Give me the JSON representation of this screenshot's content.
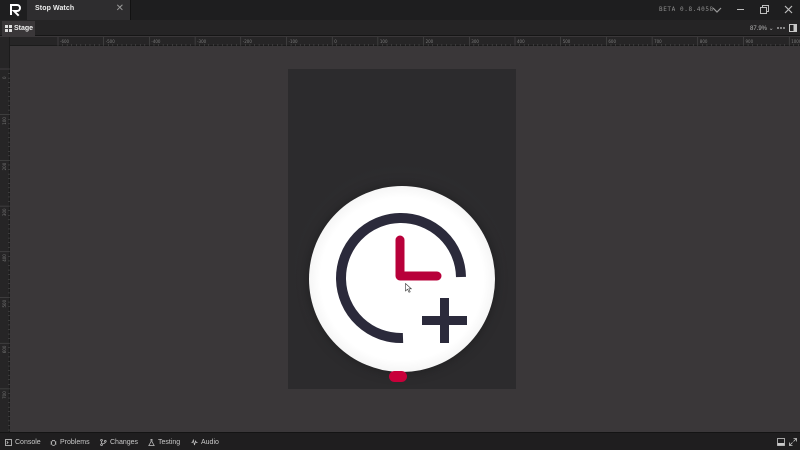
{
  "app": {
    "tab_title": "Stop Watch",
    "tab_close": "✕",
    "version": "BETA 0.8.4058",
    "logo_icon": "app-logo-icon",
    "window_controls": [
      "minimize-icon",
      "restore-icon",
      "close-icon"
    ]
  },
  "panel": {
    "tab_label": "Stage",
    "tab_icon": "grid-icon",
    "zoom": "87.9% ⌄",
    "more_icon": "more-icon",
    "layout_icon": "split-panel-icon"
  },
  "ruler": {
    "top_labels": [
      "-600",
      "-500",
      "-400",
      "-300",
      "-200",
      "-100",
      "0",
      "100",
      "200",
      "300",
      "400",
      "500",
      "600",
      "700",
      "800",
      "900",
      "1000"
    ],
    "left_labels": [
      "0",
      "100",
      "200",
      "300",
      "400",
      "500",
      "600",
      "700"
    ]
  },
  "stage": {
    "button_icon": "clock-plus-icon",
    "colors": {
      "canvas": "#3a3739",
      "artboard": "#2c2b2d",
      "icon_dark": "#2b2a3b",
      "accent": "#b8003a",
      "indicator": "#c8003a"
    }
  },
  "bottom_bar": {
    "items": [
      {
        "label": "Console",
        "icon": "console-icon"
      },
      {
        "label": "Problems",
        "icon": "bug-icon"
      },
      {
        "label": "Changes",
        "icon": "branch-icon"
      },
      {
        "label": "Testing",
        "icon": "flask-icon"
      },
      {
        "label": "Audio",
        "icon": "audio-icon"
      }
    ],
    "right_icons": [
      "panel-toggle-icon",
      "expand-icon"
    ]
  }
}
